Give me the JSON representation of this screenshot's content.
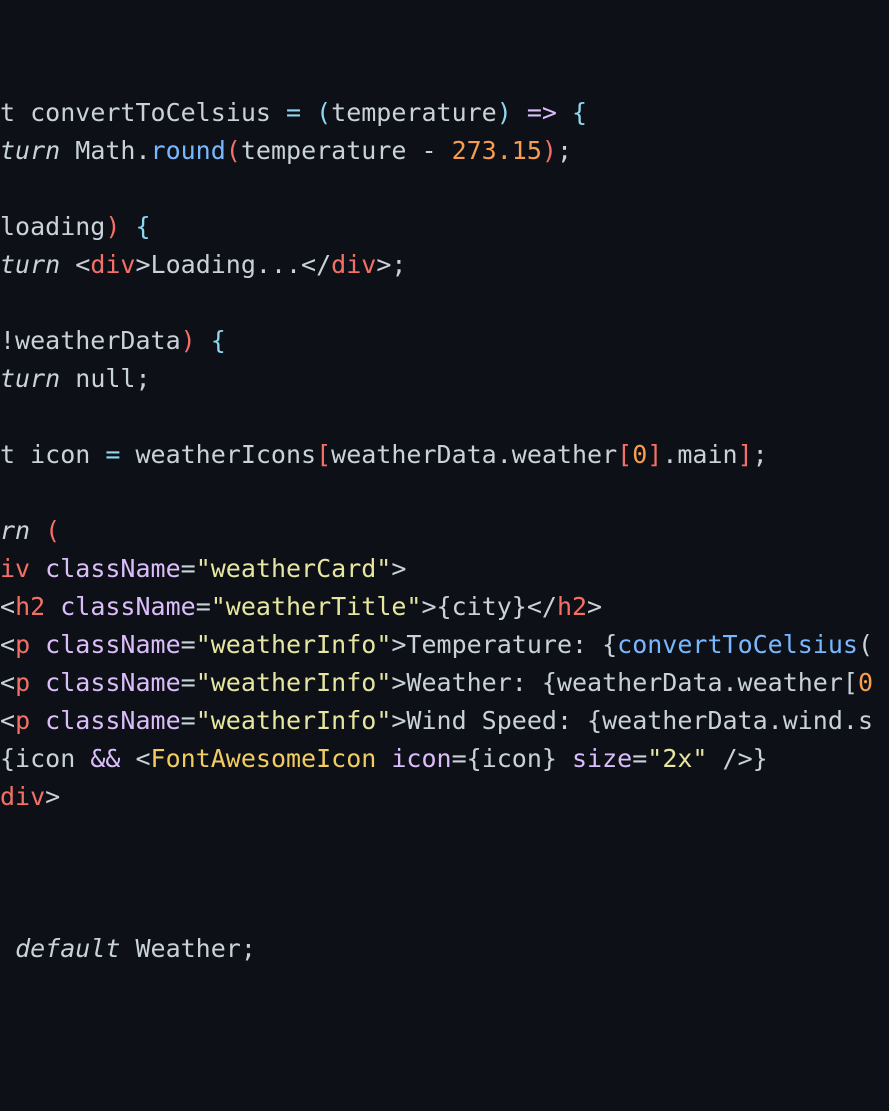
{
  "colors": {
    "background": "#0d1117",
    "plain": "#c9d1d9",
    "punctuation": "#8fd6f0",
    "paren": "#f47067",
    "keyword": "#c9d1d9",
    "function": "#79b8ff",
    "number": "#f69d50",
    "tag": "#f47067",
    "attribute": "#dcbdfb",
    "string": "#e6e6a0",
    "component": "#f2cc60"
  },
  "editor": {
    "lines": [
      {
        "tokens": [
          {
            "text": "t ",
            "c": "plain"
          },
          {
            "text": "convertToCelsius",
            "c": "plain"
          },
          {
            "text": " = ",
            "c": "punctuation"
          },
          {
            "text": "(",
            "c": "punctuation"
          },
          {
            "text": "temperature",
            "c": "plain"
          },
          {
            "text": ")",
            "c": "punctuation"
          },
          {
            "text": " => ",
            "c": "attribute"
          },
          {
            "text": "{",
            "c": "punctuation"
          }
        ]
      },
      {
        "tokens": [
          {
            "text": "turn",
            "c": "keyword",
            "italic": true
          },
          {
            "text": " Math.",
            "c": "plain"
          },
          {
            "text": "round",
            "c": "function"
          },
          {
            "text": "(",
            "c": "paren"
          },
          {
            "text": "temperature - ",
            "c": "plain"
          },
          {
            "text": "273.15",
            "c": "number"
          },
          {
            "text": ")",
            "c": "paren"
          },
          {
            "text": ";",
            "c": "plain"
          }
        ]
      },
      {
        "tokens": []
      },
      {
        "tokens": [
          {
            "text": "loading",
            "c": "plain"
          },
          {
            "text": ")",
            "c": "paren"
          },
          {
            "text": " {",
            "c": "punctuation"
          }
        ]
      },
      {
        "tokens": [
          {
            "text": "turn",
            "c": "keyword",
            "italic": true
          },
          {
            "text": " <",
            "c": "plain"
          },
          {
            "text": "div",
            "c": "tag"
          },
          {
            "text": ">Loading...</",
            "c": "plain"
          },
          {
            "text": "div",
            "c": "tag"
          },
          {
            "text": ">;",
            "c": "plain"
          }
        ]
      },
      {
        "tokens": []
      },
      {
        "tokens": [
          {
            "text": "!weatherData",
            "c": "plain"
          },
          {
            "text": ")",
            "c": "paren"
          },
          {
            "text": " {",
            "c": "punctuation"
          }
        ]
      },
      {
        "tokens": [
          {
            "text": "turn",
            "c": "keyword",
            "italic": true
          },
          {
            "text": " null;",
            "c": "plain"
          }
        ]
      },
      {
        "tokens": []
      },
      {
        "tokens": [
          {
            "text": "t icon ",
            "c": "plain"
          },
          {
            "text": "=",
            "c": "punctuation"
          },
          {
            "text": " weatherIcons",
            "c": "plain"
          },
          {
            "text": "[",
            "c": "paren"
          },
          {
            "text": "weatherData.weather",
            "c": "plain"
          },
          {
            "text": "[",
            "c": "paren"
          },
          {
            "text": "0",
            "c": "number"
          },
          {
            "text": "]",
            "c": "paren"
          },
          {
            "text": ".main",
            "c": "plain"
          },
          {
            "text": "]",
            "c": "paren"
          },
          {
            "text": ";",
            "c": "plain"
          }
        ]
      },
      {
        "tokens": []
      },
      {
        "tokens": [
          {
            "text": "rn",
            "c": "keyword",
            "italic": true
          },
          {
            "text": " (",
            "c": "paren"
          }
        ]
      },
      {
        "tokens": [
          {
            "text": "iv",
            "c": "tag"
          },
          {
            "text": " className",
            "c": "attribute"
          },
          {
            "text": "=",
            "c": "plain"
          },
          {
            "text": "\"weatherCard\"",
            "c": "string"
          },
          {
            "text": ">",
            "c": "plain"
          }
        ]
      },
      {
        "tokens": [
          {
            "text": "<",
            "c": "plain"
          },
          {
            "text": "h2",
            "c": "tag"
          },
          {
            "text": " className",
            "c": "attribute"
          },
          {
            "text": "=",
            "c": "plain"
          },
          {
            "text": "\"weatherTitle\"",
            "c": "string"
          },
          {
            "text": ">{city}</",
            "c": "plain"
          },
          {
            "text": "h2",
            "c": "tag"
          },
          {
            "text": ">",
            "c": "plain"
          }
        ]
      },
      {
        "tokens": [
          {
            "text": "<",
            "c": "plain"
          },
          {
            "text": "p",
            "c": "tag"
          },
          {
            "text": " className",
            "c": "attribute"
          },
          {
            "text": "=",
            "c": "plain"
          },
          {
            "text": "\"weatherInfo\"",
            "c": "string"
          },
          {
            "text": ">Temperature: {",
            "c": "plain"
          },
          {
            "text": "convertToCelsius",
            "c": "function"
          },
          {
            "text": "(",
            "c": "plain"
          }
        ]
      },
      {
        "tokens": [
          {
            "text": "<",
            "c": "plain"
          },
          {
            "text": "p",
            "c": "tag"
          },
          {
            "text": " className",
            "c": "attribute"
          },
          {
            "text": "=",
            "c": "plain"
          },
          {
            "text": "\"weatherInfo\"",
            "c": "string"
          },
          {
            "text": ">Weather: {weatherData.weather[",
            "c": "plain"
          },
          {
            "text": "0",
            "c": "number"
          }
        ]
      },
      {
        "tokens": [
          {
            "text": "<",
            "c": "plain"
          },
          {
            "text": "p",
            "c": "tag"
          },
          {
            "text": " className",
            "c": "attribute"
          },
          {
            "text": "=",
            "c": "plain"
          },
          {
            "text": "\"weatherInfo\"",
            "c": "string"
          },
          {
            "text": ">Wind Speed: {weatherData.wind.s",
            "c": "plain"
          }
        ]
      },
      {
        "tokens": [
          {
            "text": "{icon ",
            "c": "plain"
          },
          {
            "text": "&&",
            "c": "attribute"
          },
          {
            "text": " <",
            "c": "plain"
          },
          {
            "text": "FontAwesomeIcon",
            "c": "component"
          },
          {
            "text": " icon",
            "c": "attribute"
          },
          {
            "text": "=",
            "c": "plain"
          },
          {
            "text": "{icon}",
            "c": "plain"
          },
          {
            "text": " size",
            "c": "attribute"
          },
          {
            "text": "=",
            "c": "plain"
          },
          {
            "text": "\"2x\"",
            "c": "string"
          },
          {
            "text": " />}",
            "c": "plain"
          }
        ]
      },
      {
        "tokens": [
          {
            "text": "div",
            "c": "tag"
          },
          {
            "text": ">",
            "c": "plain"
          }
        ]
      },
      {
        "tokens": []
      },
      {
        "tokens": []
      },
      {
        "tokens": []
      },
      {
        "tokens": [
          {
            "text": " ",
            "c": "plain"
          },
          {
            "text": "default",
            "c": "keyword",
            "italic": true
          },
          {
            "text": " Weather;",
            "c": "plain"
          }
        ]
      }
    ]
  }
}
